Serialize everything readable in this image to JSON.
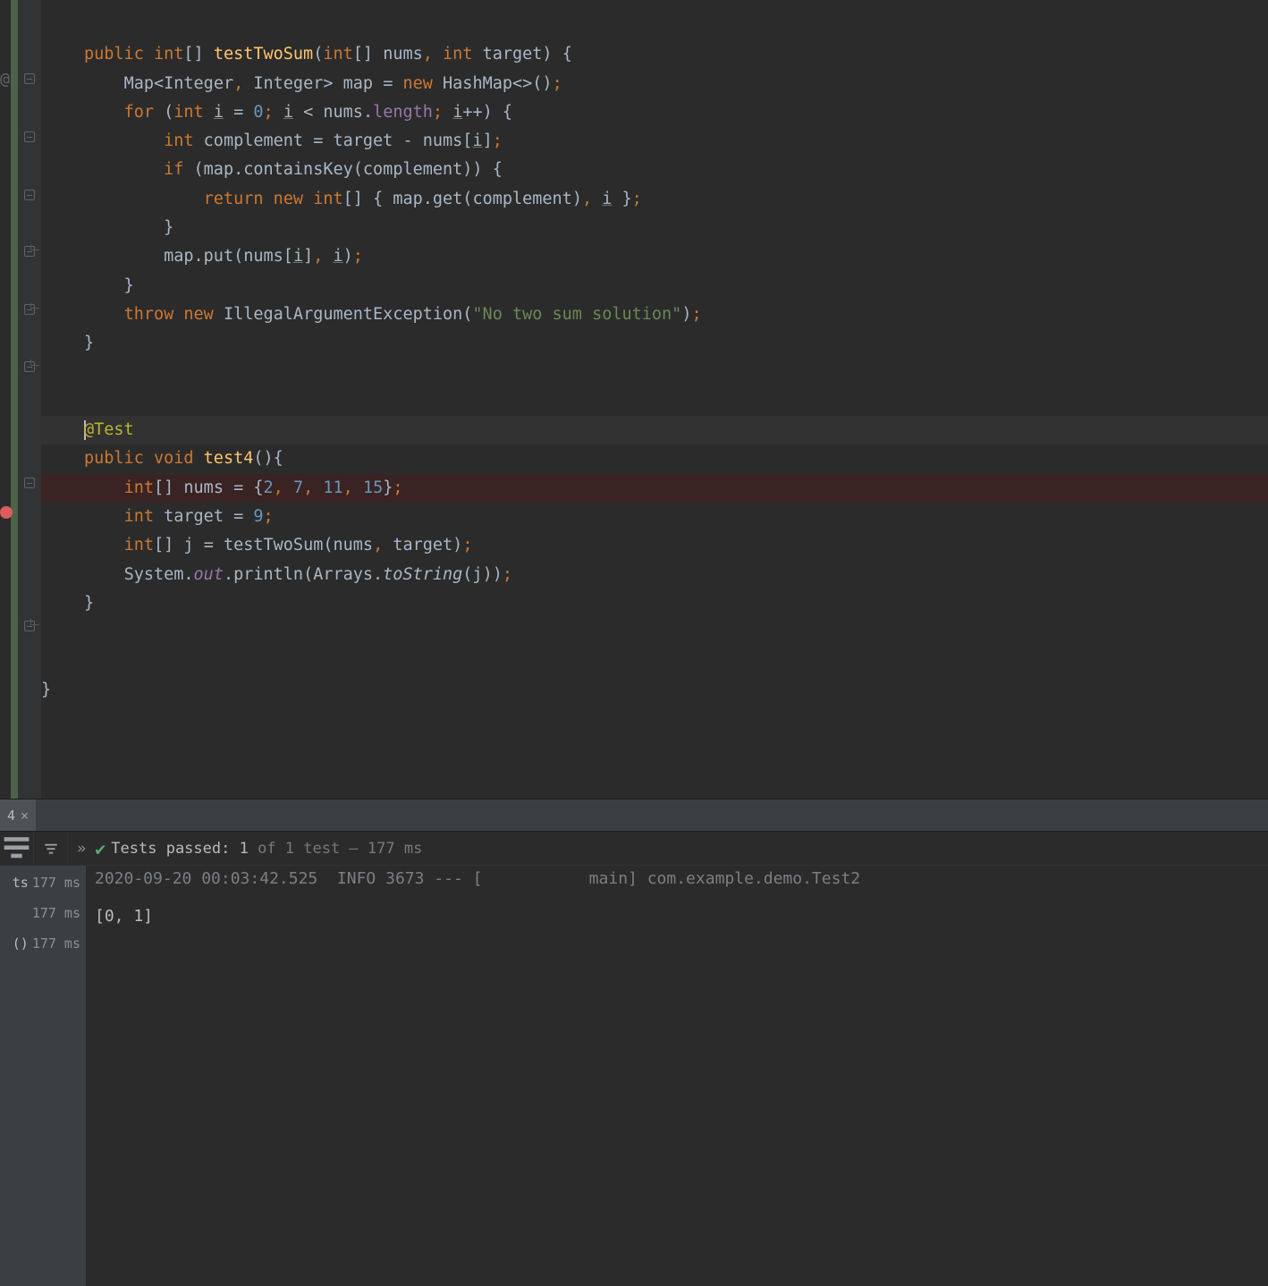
{
  "code": {
    "tokens": {
      "public": "public",
      "int": "int",
      "void": "void",
      "for": "for",
      "if": "if",
      "return": "return",
      "new": "new",
      "throw": "throw"
    },
    "method1": {
      "name": "testTwoSum",
      "param_nums": "nums",
      "param_target": "target",
      "map_var": "map",
      "Map": "Map",
      "Integer": "Integer",
      "HashMap": "HashMap",
      "i": "i",
      "zero": "0",
      "length": "length",
      "complement": "complement",
      "target": "target",
      "nums": "nums",
      "containsKey": "containsKey",
      "get": "get",
      "put": "put",
      "IAE": "IllegalArgumentException",
      "msg": "\"No two sum solution\""
    },
    "annotation": "@Test",
    "method2": {
      "name": "test4",
      "nums": "nums",
      "vals": [
        "2",
        "7",
        "11",
        "15"
      ],
      "target": "target",
      "tval": "9",
      "j": "j",
      "call": "testTwoSum",
      "System": "System",
      "out": "out",
      "println": "println",
      "Arrays": "Arrays",
      "toString": "toString"
    }
  },
  "tab": {
    "label": "4"
  },
  "tests": {
    "prefix": "Tests passed: ",
    "count": "1",
    "suffix": " of 1 test – 177 ms"
  },
  "tree": [
    {
      "label": "ts",
      "time": "177 ms"
    },
    {
      "label": "",
      "time": "177 ms"
    },
    {
      "label": "()",
      "time": "177 ms"
    }
  ],
  "console": {
    "line1": "2020-09-20 00:03:42.525  INFO 3673 --- [           main] com.example.demo.Test2",
    "line2": "",
    "line3": "[0, 1]"
  }
}
